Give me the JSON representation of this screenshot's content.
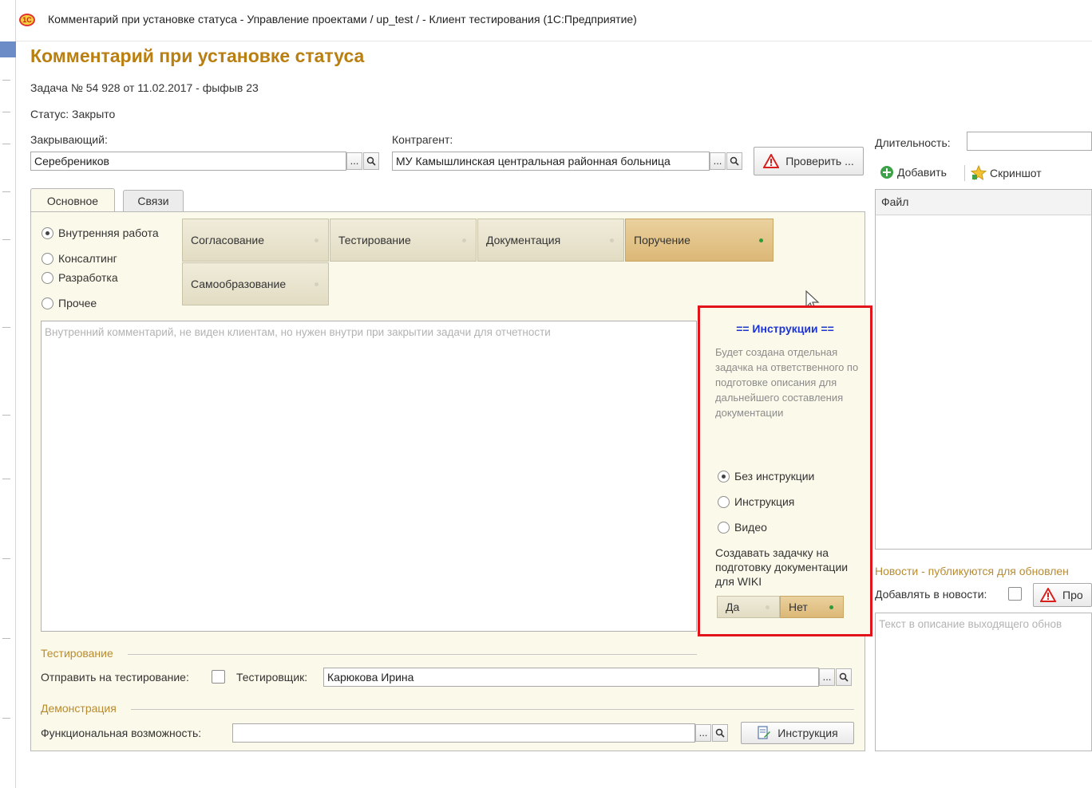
{
  "window": {
    "title": "Комментарий при установке статуса - Управление проектами / up_test /  - Клиент тестирования (1С:Предприятие)",
    "logo": "1С"
  },
  "form": {
    "title": "Комментарий при установке статуса",
    "task": "Задача № 54 928 от 11.02.2017 - фыфыв 23",
    "status": "Статус: Закрыто"
  },
  "closer": {
    "label": "Закрывающий:",
    "value": "Серебреников"
  },
  "contractor": {
    "label": "Контрагент:",
    "value": "МУ Камышлинская центральная районная больница"
  },
  "check_button": "Проверить ...",
  "select_button": "...",
  "tabs": [
    {
      "label": "Основное"
    },
    {
      "label": "Связи"
    }
  ],
  "work_types": [
    {
      "label": "Внутренняя работа",
      "selected": true
    },
    {
      "label": "Консалтинг",
      "selected": false
    },
    {
      "label": "Разработка",
      "selected": false
    },
    {
      "label": "Прочее",
      "selected": false
    }
  ],
  "categories": [
    {
      "label": "Согласование",
      "active": false
    },
    {
      "label": "Тестирование",
      "active": false
    },
    {
      "label": "Документация",
      "active": false
    },
    {
      "label": "Поручение",
      "active": true
    },
    {
      "label": "Самообразование",
      "active": false
    }
  ],
  "comment": {
    "placeholder": "Внутренний комментарий, не виден клиентам, но нужен внутри при закрытии задачи для отчетности"
  },
  "instructions": {
    "title": "== Инструкции ==",
    "description": "Будет создана отдельная задачка на ответственного по подготовке описания для дальнейшего составления документации",
    "options": [
      {
        "label": "Без инструкции",
        "selected": true
      },
      {
        "label": "Инструкция",
        "selected": false
      },
      {
        "label": "Видео",
        "selected": false
      }
    ],
    "wiki_question": "Создавать задачку на подготовку документации для WIKI",
    "yes": "Да",
    "no": "Нет",
    "wiki_selected": "Нет"
  },
  "testing": {
    "section": "Тестирование",
    "send_label": "Отправить на тестирование:",
    "send_checked": false,
    "tester_label": "Тестировщик:",
    "tester_value": "Карюкова Ирина"
  },
  "demo": {
    "section": "Демонстрация",
    "feature_label": "Функциональная возможность:",
    "feature_value": "",
    "instruction_button": "Инструкция"
  },
  "right": {
    "duration_label": "Длительность:",
    "duration_value": "",
    "add_button": "Добавить",
    "screenshot_button": "Скриншот",
    "file_column": "Файл",
    "news_label": "Новости - публикуются для обновлен",
    "add_to_news_label": "Добавлять в новости:",
    "add_to_news_checked": false,
    "news_check_button": "Про",
    "news_placeholder": "Текст в описание выходящего обнов"
  },
  "colors": {
    "form_title": "#b97f10",
    "instructions_title": "#1c34d6",
    "highlight_border": "#e1141c",
    "active_category": "#dcb877",
    "section_label": "#b98b30"
  }
}
